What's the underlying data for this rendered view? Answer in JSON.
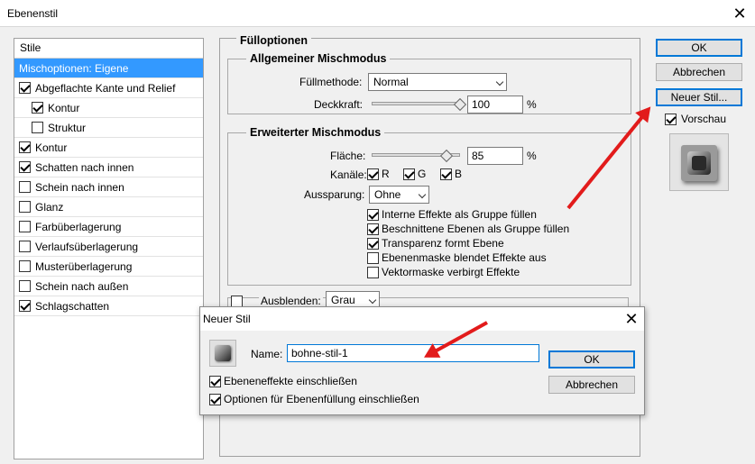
{
  "window": {
    "title": "Ebenenstil",
    "close_glyph": "✕"
  },
  "styles": {
    "header": "Stile",
    "items": [
      {
        "label": "Mischoptionen: Eigene",
        "checkbox": false,
        "checked": false,
        "selected": true,
        "indent": false
      },
      {
        "label": "Abgeflachte Kante und Relief",
        "checkbox": true,
        "checked": true,
        "selected": false,
        "indent": false
      },
      {
        "label": "Kontur",
        "checkbox": true,
        "checked": true,
        "selected": false,
        "indent": true
      },
      {
        "label": "Struktur",
        "checkbox": true,
        "checked": false,
        "selected": false,
        "indent": true
      },
      {
        "label": "Kontur",
        "checkbox": true,
        "checked": true,
        "selected": false,
        "indent": false
      },
      {
        "label": "Schatten nach innen",
        "checkbox": true,
        "checked": true,
        "selected": false,
        "indent": false
      },
      {
        "label": "Schein nach innen",
        "checkbox": true,
        "checked": false,
        "selected": false,
        "indent": false
      },
      {
        "label": "Glanz",
        "checkbox": true,
        "checked": false,
        "selected": false,
        "indent": false
      },
      {
        "label": "Farbüberlagerung",
        "checkbox": true,
        "checked": false,
        "selected": false,
        "indent": false
      },
      {
        "label": "Verlaufsüberlagerung",
        "checkbox": true,
        "checked": false,
        "selected": false,
        "indent": false
      },
      {
        "label": "Musterüberlagerung",
        "checkbox": true,
        "checked": false,
        "selected": false,
        "indent": false
      },
      {
        "label": "Schein nach außen",
        "checkbox": true,
        "checked": false,
        "selected": false,
        "indent": false
      },
      {
        "label": "Schlagschatten",
        "checkbox": true,
        "checked": true,
        "selected": false,
        "indent": false
      }
    ]
  },
  "fill_options": {
    "title": "Fülloptionen",
    "general": {
      "title": "Allgemeiner Mischmodus",
      "blend_label": "Füllmethode:",
      "blend_value": "Normal",
      "opacity_label": "Deckkraft:",
      "opacity_value": "100",
      "opacity_fraction": 1.0,
      "percent": "%"
    },
    "advanced": {
      "title": "Erweiterter Mischmodus",
      "fill_label": "Fläche:",
      "fill_value": "85",
      "fill_fraction": 0.85,
      "percent": "%",
      "channels_label": "Kanäle:",
      "channels": [
        {
          "label": "R",
          "checked": true
        },
        {
          "label": "G",
          "checked": true
        },
        {
          "label": "B",
          "checked": true
        }
      ],
      "knockout_label": "Aussparung:",
      "knockout_value": "Ohne",
      "options": [
        {
          "label": "Interne Effekte als Gruppe füllen",
          "checked": true
        },
        {
          "label": "Beschnittene Ebenen als Gruppe füllen",
          "checked": true
        },
        {
          "label": "Transparenz formt Ebene",
          "checked": true
        },
        {
          "label": "Ebenenmaske blendet Effekte aus",
          "checked": false
        },
        {
          "label": "Vektormaske verbirgt Effekte",
          "checked": false
        }
      ]
    },
    "blend_if": {
      "label": "Ausblenden:",
      "value": "Grau"
    }
  },
  "right_buttons": {
    "ok": "OK",
    "cancel": "Abbrechen",
    "new_style": "Neuer Stil...",
    "preview_label": "Vorschau",
    "preview_checked": true
  },
  "new_style_dialog": {
    "title": "Neuer Stil",
    "close_glyph": "✕",
    "name_label": "Name:",
    "name_value": "bohne-stil-1",
    "include_effects": "Ebeneneffekte einschließen",
    "include_fill": "Optionen für Ebenenfüllung einschließen",
    "ok": "OK",
    "cancel": "Abbrechen"
  },
  "colors": {
    "selection": "#3399ff",
    "arrow": "#e21b1b",
    "dialog_bg": "#f0f0f0",
    "default_button_border": "#0078d7"
  }
}
